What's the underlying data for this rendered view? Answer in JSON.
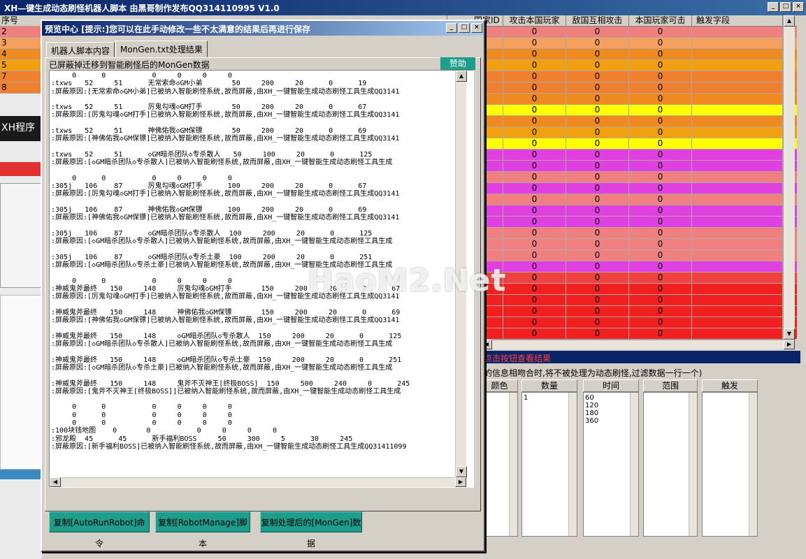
{
  "main_window": {
    "title": "XH—键生成动态刷怪机器人脚本 由黑哥制作发布QQ314110995 V1.0",
    "buttons": [
      "_",
      "□",
      "×"
    ]
  },
  "grid": {
    "left_header": "序号",
    "headers": [
      "攻击本国玩家",
      "敌国互相攻击",
      "本国玩家可击",
      "触发字段"
    ],
    "partial_header": "国家ID",
    "row_labels": [
      "2",
      "3",
      "4",
      "5",
      "7",
      "8"
    ],
    "row_colors": [
      "#f08080",
      "#f4a060",
      "#ee8a20",
      "#f0a010",
      "#ee8030",
      "#ee8030",
      "#ee8a20",
      "#ffff00",
      "#ee8a20",
      "#f0a010",
      "#ffff00",
      "#e040e0",
      "#e040e0",
      "#f08080",
      "#e040e0",
      "#f08080",
      "#e040e0",
      "#e040e0",
      "#f08080",
      "#f08080",
      "#f08080",
      "#e040e0",
      "#f04040",
      "#f02020",
      "#f02020",
      "#f02020",
      "#f02020",
      "#f02020"
    ],
    "cell_value": "0"
  },
  "xh_panel_label": "XH程序",
  "status_strip": "点击按钮查看结果",
  "filter_caption": "的信息相吻合时,将不被处理为动态刷怪,过滤数据一行一个)",
  "filters": {
    "color": {
      "title": "颜色",
      "items": []
    },
    "count": {
      "title": "数量",
      "items": [
        "1"
      ]
    },
    "time": {
      "title": "时间",
      "items": [
        "60",
        "120",
        "180",
        "360"
      ]
    },
    "range": {
      "title": "范围",
      "items": []
    },
    "trigger": {
      "title": "触发",
      "items": []
    }
  },
  "dialog": {
    "title": "预览中心 [提示:]您可以在此手动修改一些不太满意的结果后再进行保存",
    "buttons": [
      "_",
      "□",
      "×"
    ],
    "tabs": [
      "机器人脚本内容",
      "MonGen.txt处理结果"
    ],
    "group_label": "已屏蔽掉迁移到智能刷怪后的MonGen数据",
    "donate": "赞助",
    "lines": [
      "     0      0           0     0     0     0",
      ":txws   52     51      无常索命◇GM小弟       50     200     20      0      19",
      ":屏蔽原因:[无常索命◇GM小弟]已被纳入智能刷怪系统,故而屏蔽,由XH_一键智能生成动态刷怪工具生成QQ3141",
      "",
      ":txws   52     51      厉鬼勾魂◇GM打手       50     200     20      0      67",
      ":屏蔽原因:[厉鬼勾魂◇GM打手]已被纳入智能刷怪系统,故而屏蔽,由XH_一键智能生成动态刷怪工具生成QQ3141",
      "",
      ":txws   52     51      神佛佑我◇GM保镖       50     200     20      0      69",
      ":屏蔽原因:[神佛佑我◇GM保镖]已被纳入智能刷怪系统,故而屏蔽,由XH_一键智能生成动态刷怪工具生成QQ3141",
      "",
      ":txws   52     51      ◇GM暗杀团队◇专杀散人   50     100     20      0      125",
      ":屏蔽原因:[◇GM暗杀团队◇专杀散人]已被纳入智能刷怪系统,故而屏蔽,由XH_一键智能生成动态刷怪工具生成",
      "",
      "     0      0           0     0     0     0",
      ":305j   106    87      厉鬼勾魂◇GM打手      100     200     20      0      67",
      ":屏蔽原因:[厉鬼勾魂◇GM打手]已被纳入智能刷怪系统,故而屏蔽,由XH_一键智能生成动态刷怪工具生成QQ3141",
      "",
      ":305j   106    87      神佛佑我◇GM保镖      100     200     20      0      69",
      ":屏蔽原因:[神佛佑我◇GM保镖]已被纳入智能刷怪系统,故而屏蔽,由XH_一键智能生成动态刷怪工具生成QQ3141",
      "",
      ":305j   106    87      ◇GM暗杀团队◇专杀散人  100     200     20      0      125",
      ":屏蔽原因:[◇GM暗杀团队◇专杀散人]已被纳入智能刷怪系统,故而屏蔽,由XH_一键智能生成动态刷怪工具生成",
      "",
      ":305j   106    87      ◇GM暗杀团队◇专杀土豪  100     200     20      0      251",
      ":屏蔽原因:[◇GM暗杀团队◇专杀土豪]已被纳入智能刷怪系统,故而屏蔽,由XH_一键智能生成动态刷怪工具生成",
      "",
      "     0      0           0     0     0     0",
      ":神威鬼斧最终   150     148     厉鬼勾魂◇GM打手       150     200     20      0      67",
      ":屏蔽原因:[厉鬼勾魂◇GM打手]已被纳入智能刷怪系统,故而屏蔽,由XH_一键智能生成动态刷怪工具生成QQ3141",
      "",
      ":神威鬼斧最终   150     148     神佛佑我◇GM保镖       150     200     20      0      69",
      ":屏蔽原因:[神佛佑我◇GM保镖]已被纳入智能刷怪系统,故而屏蔽,由XH_一键智能生成动态刷怪工具生成QQ3141",
      "",
      ":神威鬼斧最终   150     148     ◇GM暗杀团队◇专杀散人  150     200     20      0      125",
      ":屏蔽原因:[◇GM暗杀团队◇专杀散人]已被纳入智能刷怪系统,故而屏蔽,由XH_一键智能生成动态刷怪工具生成",
      "",
      ":神威鬼斧最终   150     148     ◇GM暗杀团队◇专杀土豪  150     200     20      0      251",
      ":屏蔽原因:[◇GM暗杀团队◇专杀土豪]已被纳入智能刷怪系统,故而屏蔽,由XH_一键智能生成动态刷怪工具生成",
      "",
      ":神威鬼斧最终   150     148     鬼斧不灭神王[终极BOSS]  150     500     240     0      245",
      ":屏蔽原因:[鬼斧不灭神王[终极BOSS]]已被纳入智能刷怪系统,故而屏蔽,由XH_一键智能生成动态刷怪工具生成",
      "",
      "     0      0           0     0     0     0",
      "     0      0           0     0     0     0",
      "     0      0           0     0     0     0",
      ":100块钱地图    0       0           0     0     0     0",
      ":邪龙殿  45      45      新手福利BOSS     50     300     5      30     245",
      ":屏蔽原因:[新手福利BOSS]已被纳入智能刷怪系统,故而屏蔽,由XH_一键智能生成动态刷怪工具生成QQ31411099"
    ],
    "action_buttons": [
      "复制[AutoRunRobot]命令",
      "复制[RobotManage]脚本",
      "复制处理后的[MonGen]数据"
    ]
  },
  "watermark": "HaoM2.Net"
}
